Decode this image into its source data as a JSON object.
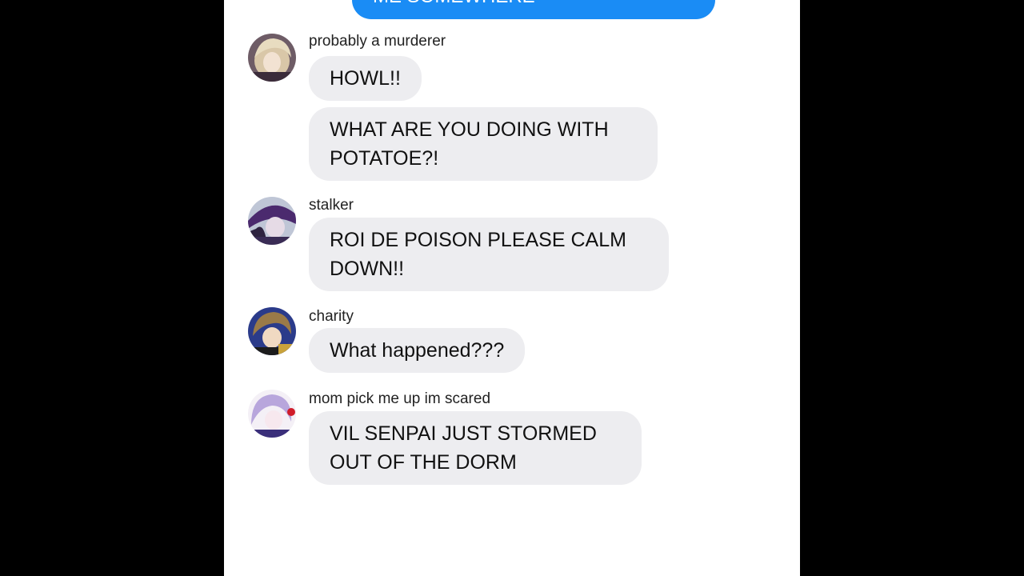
{
  "sent_message": {
    "text": "ME SOMEWHERE"
  },
  "messages": [
    {
      "sender": "probably a murderer",
      "avatar": "avatar-blonde-character-icon",
      "bubbles": [
        "HOWL!!",
        "WHAT ARE YOU DOING WITH\nPOTATOE?!"
      ]
    },
    {
      "sender": "stalker",
      "avatar": "avatar-purple-hat-character-icon",
      "bubbles": [
        "ROI DE POISON PLEASE CALM\nDOWN!!"
      ]
    },
    {
      "sender": "charity",
      "avatar": "avatar-brown-hair-character-icon",
      "bubbles": [
        "What happened???"
      ]
    },
    {
      "sender": "mom pick me up im scared",
      "avatar": "avatar-lavender-hair-character-icon",
      "bubbles": [
        "VIL SENPAI JUST STORMED\nOUT OF THE DORM"
      ]
    }
  ],
  "colors": {
    "sent_bubble": "#1a8cf5",
    "received_bubble": "#ededf0",
    "background": "#ffffff",
    "letterbox": "#000000"
  }
}
